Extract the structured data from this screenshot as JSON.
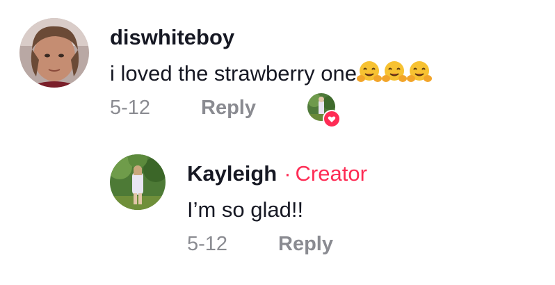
{
  "comments": [
    {
      "username": "diswhiteboy",
      "text": "i loved the strawberry one",
      "emoji": [
        "hugging-face",
        "hugging-face",
        "hugging-face"
      ],
      "date": "5-12",
      "reply_label": "Reply",
      "liked_by_creator": true
    },
    {
      "username": "Kayleigh",
      "creator_dot": "·",
      "creator_label": "Creator",
      "text": "I’m so glad!!",
      "date": "5-12",
      "reply_label": "Reply"
    }
  ],
  "colors": {
    "creator_accent": "#fe2c55",
    "meta_gray": "#8a8b91",
    "text_primary": "#161823"
  }
}
